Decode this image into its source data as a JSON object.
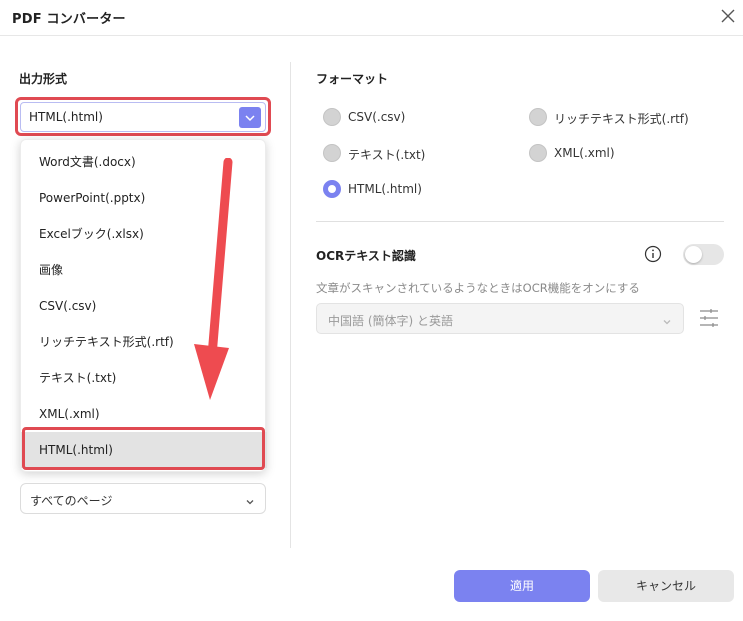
{
  "window": {
    "title": "PDF コンバーター"
  },
  "left_panel": {
    "output_format_label": "出力形式",
    "selected_format": "HTML(.html)",
    "format_options": [
      "Word文書(.docx)",
      "PowerPoint(.pptx)",
      "Excelブック(.xlsx)",
      "画像",
      "CSV(.csv)",
      "リッチテキスト形式(.rtf)",
      "テキスト(.txt)",
      "XML(.xml)",
      "HTML(.html)"
    ],
    "page_range_value": "すべてのページ"
  },
  "right_panel": {
    "format_heading": "フォーマット",
    "radio_options": [
      {
        "label": "CSV(.csv)",
        "checked": false
      },
      {
        "label": "リッチテキスト形式(.rtf)",
        "checked": false
      },
      {
        "label": "テキスト(.txt)",
        "checked": false
      },
      {
        "label": "XML(.xml)",
        "checked": false
      },
      {
        "label": "HTML(.html)",
        "checked": true
      }
    ],
    "ocr_heading": "OCRテキスト認識",
    "ocr_enabled": false,
    "ocr_hint": "文章がスキャンされているようなときはOCR機能をオンにする",
    "ocr_language": "中国語 (簡体字) と英語"
  },
  "footer": {
    "apply_label": "適用",
    "cancel_label": "キャンセル"
  },
  "colors": {
    "accent": "#7b82f0",
    "highlight_outline": "#e04a52",
    "annotation_arrow": "#ee4b50"
  },
  "icons": [
    "close-icon",
    "chevron-down-icon",
    "info-icon",
    "settings-sliders-icon",
    "annotation-arrow"
  ]
}
